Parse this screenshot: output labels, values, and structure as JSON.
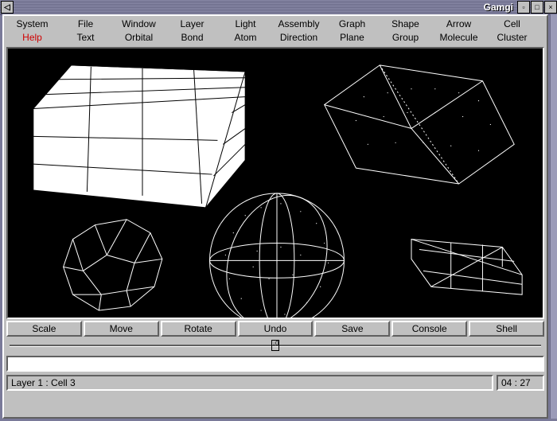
{
  "titlebar": {
    "app_name": "Gamgi",
    "left_button_glyph": "◁",
    "close_glyph": "×",
    "max_glyph": "□",
    "min_glyph": "▫"
  },
  "menu": {
    "row1": [
      "System",
      "File",
      "Window",
      "Layer",
      "Light",
      "Assembly",
      "Graph",
      "Shape",
      "Arrow",
      "Cell"
    ],
    "row2": [
      "Help",
      "Text",
      "Orbital",
      "Bond",
      "Atom",
      "Direction",
      "Plane",
      "Group",
      "Molecule",
      "Cluster"
    ]
  },
  "tools": [
    "Scale",
    "Move",
    "Rotate",
    "Undo",
    "Save",
    "Console",
    "Shell"
  ],
  "slider": {
    "value_glyph": "↓0"
  },
  "textinput": {
    "value": ""
  },
  "status": {
    "left": "Layer 1 : Cell 3",
    "right": "04 : 27"
  }
}
